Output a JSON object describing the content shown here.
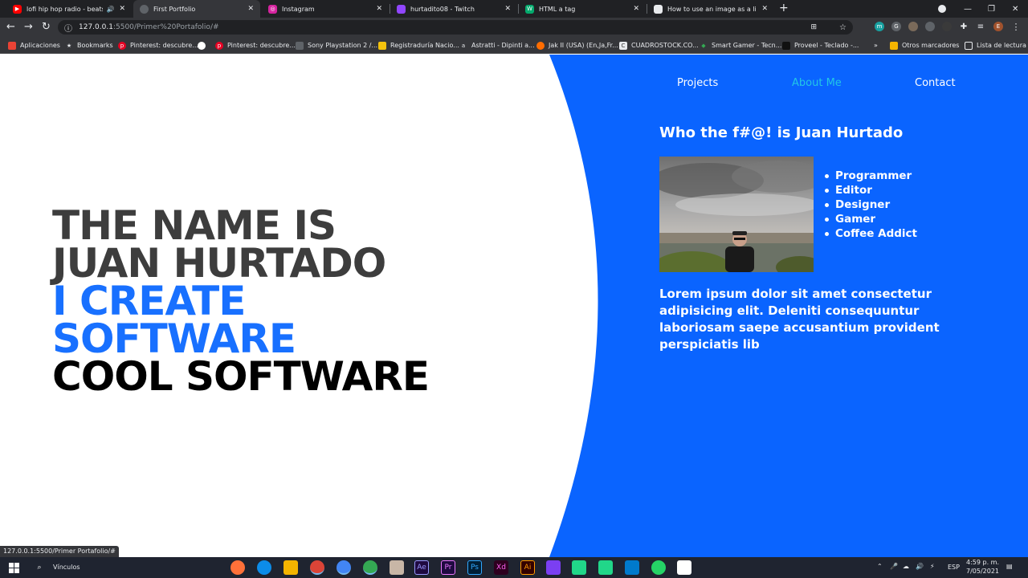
{
  "browser": {
    "tabs": [
      {
        "title": "lofi hip hop radio - beats to r",
        "icon": "youtube-icon",
        "color": "#ff0000",
        "audio": true
      },
      {
        "title": "First Portfolio",
        "icon": "globe-icon",
        "color": "#9aa0a6",
        "active": true
      },
      {
        "title": "Instagram",
        "icon": "instagram-icon",
        "color": "#d6249f"
      },
      {
        "title": "hurtadito08 - Twitch",
        "icon": "twitch-icon",
        "color": "#9146ff"
      },
      {
        "title": "HTML a tag",
        "icon": "w3schools-icon",
        "color": "#04aa6d"
      },
      {
        "title": "How to use an image as a link in",
        "icon": "stackoverflow-icon",
        "color": "#f48024"
      }
    ],
    "url_host": "127.0.0.1",
    "url_path": ":5500/Primer%20Portafolio/#",
    "bookmarks": [
      {
        "label": "Aplicaciones",
        "icon": "apps-grid-icon",
        "color": "#ea4335"
      },
      {
        "label": "Bookmarks",
        "icon": "star-icon",
        "color": "#e8eaed"
      },
      {
        "label": "Pinterest: descubre...",
        "icon": "pinterest-icon",
        "color": "#e60023"
      },
      {
        "label": "",
        "icon": "github-icon",
        "color": "#ffffff"
      },
      {
        "label": "Pinterest: descubre...",
        "icon": "pinterest-icon",
        "color": "#e60023"
      },
      {
        "label": "Sony Playstation 2 /...",
        "icon": "emulator-icon",
        "color": "#5f6368"
      },
      {
        "label": "Registraduría Nacio...",
        "icon": "registraduria-icon",
        "color": "#f4c20d"
      },
      {
        "label": "Astratti - Dipinti a...",
        "icon": "amazon-icon",
        "color": "#e8eaed"
      },
      {
        "label": "Jak II (USA) (En,Ja,Fr...",
        "icon": "jak-icon",
        "color": "#ff6d00"
      },
      {
        "label": "CUADROSTOCK.CO...",
        "icon": "cuadrostock-icon",
        "color": "#e8eaed"
      },
      {
        "label": "Smart Gamer - Tecn...",
        "icon": "smartgamer-icon",
        "color": "#34a853"
      },
      {
        "label": "Proveel - Teclado -...",
        "icon": "proveel-icon",
        "color": "#111111"
      }
    ],
    "bookmarks_more": "»",
    "other_bookmarks": "Otros marcadores",
    "reading_list": "Lista de lectura",
    "status_url": "127.0.0.1:5500/Primer Portafolio/#"
  },
  "page": {
    "nav": {
      "projects": "Projects",
      "about": "About Me",
      "contact": "Contact"
    },
    "hero": {
      "line1": "THE NAME IS",
      "line2": "JUAN HURTADO",
      "line3": "I CREATE",
      "line4": "SOFTWARE",
      "line5": "COOL SOFTWARE"
    },
    "about_title": "Who the f#@! is Juan Hurtado",
    "skills": [
      "Programmer",
      "Editor",
      "Designer",
      "Gamer",
      "Coffee Addict"
    ],
    "lorem": "Lorem ipsum dolor sit amet consectetur adipisicing elit. Deleniti consequuntur laboriosam saepe accusantium provident perspiciatis lib",
    "colors": {
      "panel": "#0a64ff",
      "accent": "#1870ff",
      "nav_active": "#22c7e6"
    }
  },
  "taskbar": {
    "search_label": "Vínculos",
    "lang": "ESP",
    "time": "4:59 p. m.",
    "date": "7/05/2021"
  }
}
